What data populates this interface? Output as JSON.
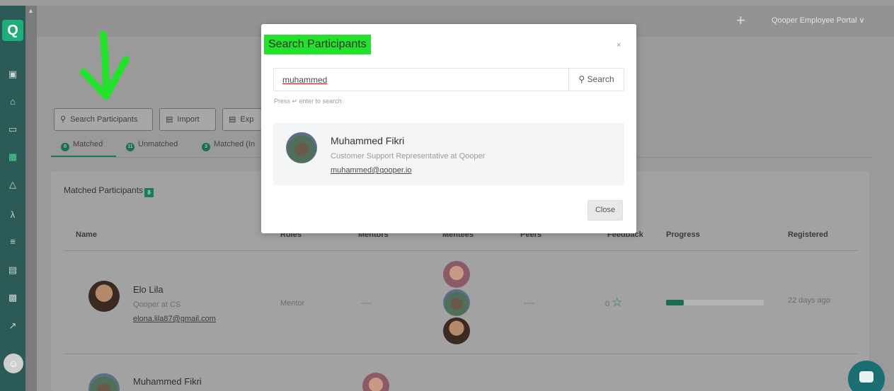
{
  "app": {
    "logo_letter": "Q",
    "portal_label": "Qooper Employee Portal ∨",
    "plus_icon": "plus-icon"
  },
  "sidebar": {
    "icons": [
      "briefcase-icon",
      "home-icon",
      "laptop-icon",
      "grid-icon",
      "network-icon",
      "person-icon",
      "list-icon",
      "calendar-icon",
      "id-card-icon",
      "chart-icon"
    ],
    "active_icon": "grid-icon"
  },
  "toolbar": {
    "search_participants": "Search Participants",
    "import": "Import",
    "export": "Exp"
  },
  "tabs": [
    {
      "count": "8",
      "label": "Matched"
    },
    {
      "count": "11",
      "label": "Unmatched"
    },
    {
      "count": "3",
      "label": "Matched (In"
    }
  ],
  "panel": {
    "title": "Matched Participants",
    "count": "8"
  },
  "table": {
    "headers": {
      "name": "Name",
      "roles": "Roles",
      "mentors": "Mentors",
      "mentees": "Mentees",
      "peers": "Peers",
      "feedback": "Feedback",
      "progress": "Progress",
      "registered": "Registered"
    },
    "rows": [
      {
        "name": "Elo Lila",
        "subtitle": "Qooper at CS",
        "email": "elona.lila87@gmail.com",
        "role": "Mentor",
        "mentors": "----",
        "peers": "----",
        "feedback": "0",
        "progress": 0.18,
        "registered": "22 days ago"
      },
      {
        "name": "Muhammed Fikri"
      }
    ]
  },
  "modal": {
    "title": "Search Participants",
    "close_x": "×",
    "search_value": "muhammed",
    "search_button": "Search",
    "hint": "Press ↵ enter to search",
    "result": {
      "name": "Muhammed Fikri",
      "role": "Customer Support Representative at Qooper",
      "email": "muhammed@qooper.io"
    },
    "close_button": "Close"
  },
  "colors": {
    "highlight": "#22e22b",
    "arrow": "#22e22b",
    "brand": "#1c7a55"
  }
}
